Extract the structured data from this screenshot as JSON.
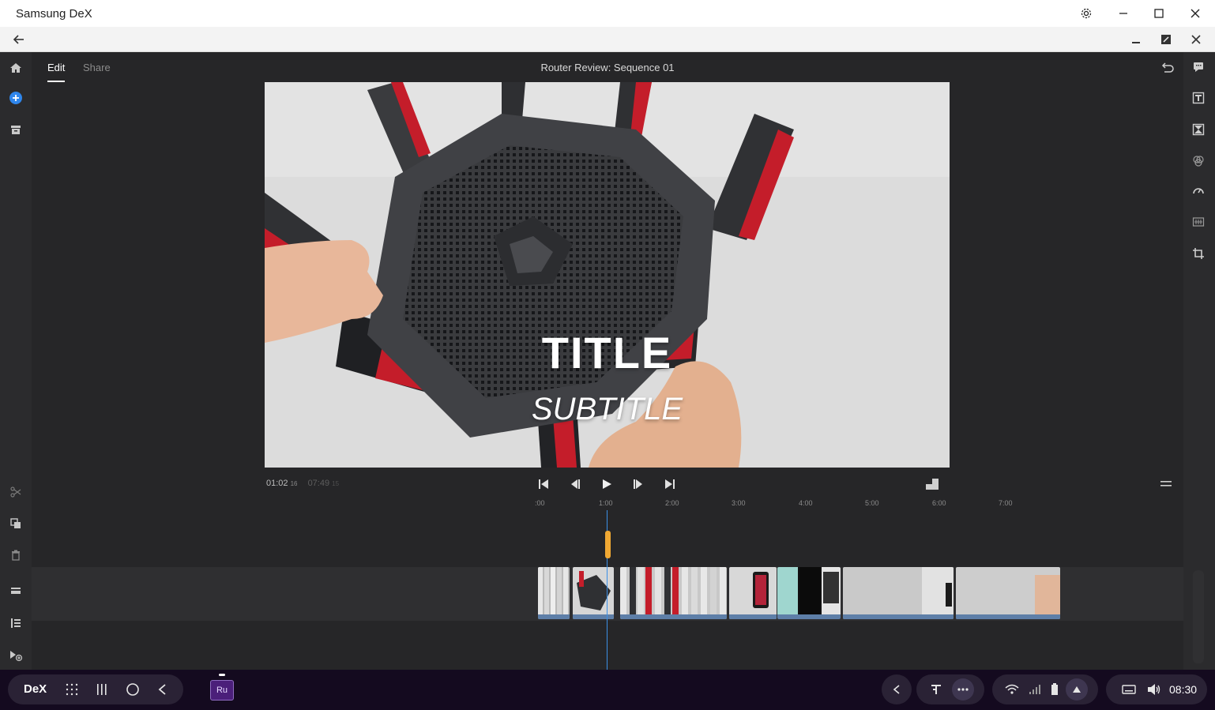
{
  "window": {
    "title": "Samsung DeX"
  },
  "app": {
    "tabs": [
      {
        "label": "Edit"
      },
      {
        "label": "Share"
      }
    ],
    "sequence_title": "Router Review: Sequence 01"
  },
  "preview": {
    "overlay_title": "TITLE",
    "overlay_subtitle": "SUBTITLE"
  },
  "playback": {
    "current_time": "01:02",
    "current_frames": "16",
    "total_time": "07:49",
    "total_frames": "15"
  },
  "ruler": {
    "labels": [
      ":00",
      "1:00",
      "2:00",
      "3:00",
      "4:00",
      "5:00",
      "6:00",
      "7:00"
    ]
  },
  "taskbar": {
    "dex_label": "DeX",
    "app_icon_label": "Ru",
    "clock": "08:30"
  },
  "colors": {
    "accent": "#3b8fe6",
    "playhead_handle": "#f0a833",
    "app_icon": "#4b1f7a"
  }
}
